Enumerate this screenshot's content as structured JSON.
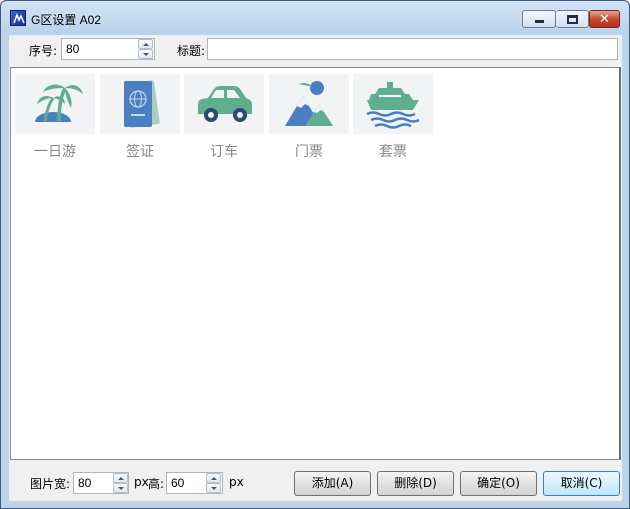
{
  "window": {
    "title": "G区设置 A02",
    "close_glyph": "✕"
  },
  "form": {
    "index_label": "序号:",
    "index_value": "80",
    "title_label": "标题:",
    "title_value": ""
  },
  "tiles": [
    {
      "label": "一日游",
      "icon": "palm-island-icon"
    },
    {
      "label": "签证",
      "icon": "passport-icon"
    },
    {
      "label": "订车",
      "icon": "car-icon"
    },
    {
      "label": "门票",
      "icon": "mountain-icon"
    },
    {
      "label": "套票",
      "icon": "cruise-ship-icon"
    }
  ],
  "footer": {
    "width_label": "图片宽:",
    "width_value": "80",
    "width_unit": "px",
    "height_label": "高:",
    "height_value": "60",
    "height_unit": "px"
  },
  "buttons": {
    "add": "添加(A)",
    "delete": "删除(D)",
    "ok": "确定(O)",
    "cancel": "取消(C)"
  },
  "colors": {
    "icon_blue": "#4a7fc1",
    "icon_green": "#5fae8f"
  }
}
